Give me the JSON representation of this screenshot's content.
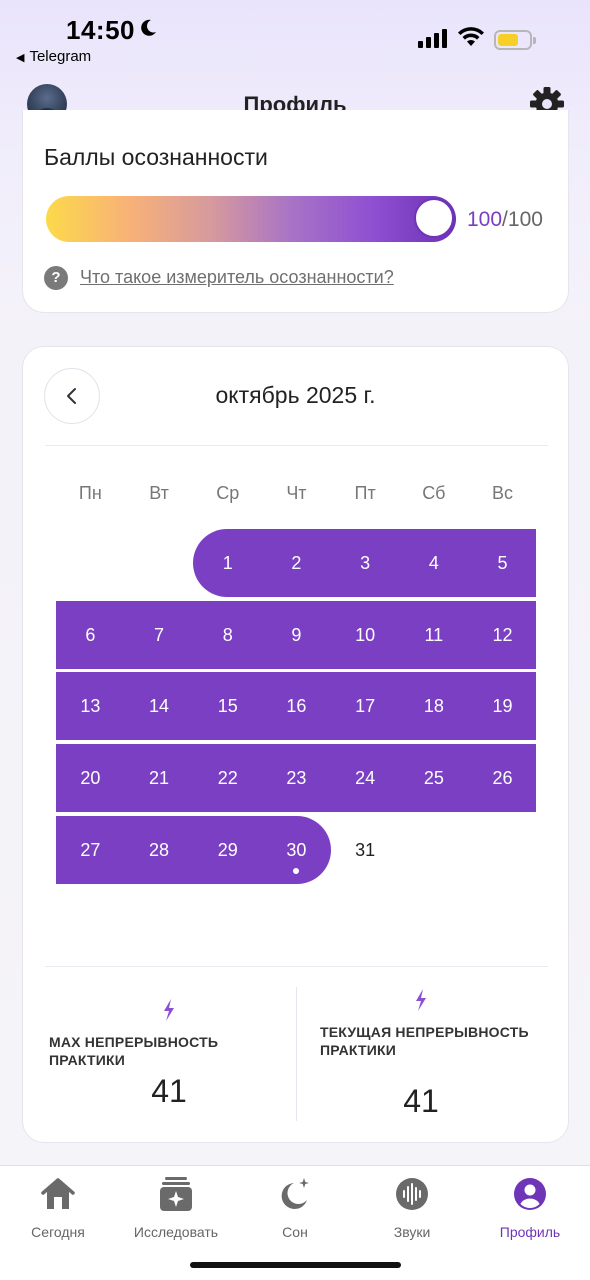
{
  "status_bar": {
    "time": "14:50",
    "back_app": "Telegram",
    "battery_color": "#f6d028"
  },
  "header": {
    "title": "Профиль",
    "avatar_icon": "user-avatar",
    "settings_icon": "gear-icon"
  },
  "mindfulness": {
    "title": "Баллы осознанности",
    "score": "100",
    "separator": "/",
    "max": "100",
    "level_fraction": 1.0,
    "help_text": "Что такое измеритель осознанности?",
    "accent": "#7a3fc0"
  },
  "calendar": {
    "month_label": "октябрь 2025 г.",
    "weekdays": [
      "Пн",
      "Вт",
      "Ср",
      "Чт",
      "Пт",
      "Сб",
      "Вс"
    ],
    "days": [
      "1",
      "2",
      "3",
      "4",
      "5",
      "6",
      "7",
      "8",
      "9",
      "10",
      "11",
      "12",
      "13",
      "14",
      "15",
      "16",
      "17",
      "18",
      "19",
      "20",
      "21",
      "22",
      "23",
      "24",
      "25",
      "26",
      "27",
      "28",
      "29",
      "30",
      "31"
    ],
    "practiced_through": 30,
    "today": "30",
    "highlight_color": "#7b3fc4"
  },
  "stats": {
    "max_streak_label": "MAX НЕПРЕРЫВНОСТЬ ПРАКТИКИ",
    "max_streak_value": "41",
    "current_streak_label": "ТЕКУЩАЯ НЕПРЕРЫВНОСТЬ ПРАКТИКИ",
    "current_streak_value": "41"
  },
  "tabbar": {
    "tabs": [
      {
        "label": "Сегодня",
        "icon": "home-icon"
      },
      {
        "label": "Исследовать",
        "icon": "explore-icon"
      },
      {
        "label": "Сон",
        "icon": "moon-stars-icon"
      },
      {
        "label": "Звуки",
        "icon": "sound-wave-icon"
      },
      {
        "label": "Профиль",
        "icon": "profile-icon"
      }
    ],
    "active_index": 4,
    "active_color": "#6f35b8"
  }
}
